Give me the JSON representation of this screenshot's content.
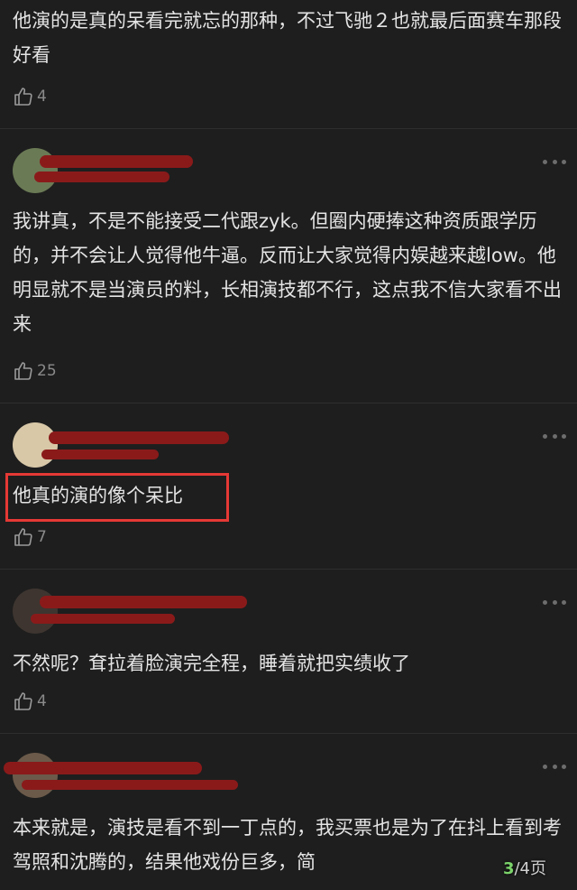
{
  "comments": [
    {
      "text": "他演的是真的呆看完就忘的那种，不过飞驰２也就最后面赛车那段好看",
      "likes": "4"
    },
    {
      "text": "我讲真，不是不能接受二代跟zyk。但圈内硬捧这种资质跟学历的，并不会让人觉得他牛逼。反而让大家觉得内娱越来越low。他明显就不是当演员的料，长相演技都不行，这点我不信大家看不出来",
      "likes": "25"
    },
    {
      "text": "他真的演的像个呆比",
      "likes": "7",
      "highlighted": true
    },
    {
      "text": "不然呢？耷拉着脸演完全程，睡着就把实绩收了",
      "likes": "4"
    },
    {
      "text": "本来就是，演技是看不到一丁点的，我买票也是为了在抖上看到考驾照和沈腾的，结果他戏份巨多，简",
      "likes": ""
    }
  ],
  "pager": {
    "current": "3",
    "rest": "/4页"
  },
  "colors": {
    "background": "#1e1e1e",
    "highlight_border": "#e53935",
    "redaction": "#8a1a1a",
    "pager_current": "#7bd36a"
  },
  "icons": {
    "like": "thumbs-up-icon",
    "more": "more-dots-icon"
  }
}
